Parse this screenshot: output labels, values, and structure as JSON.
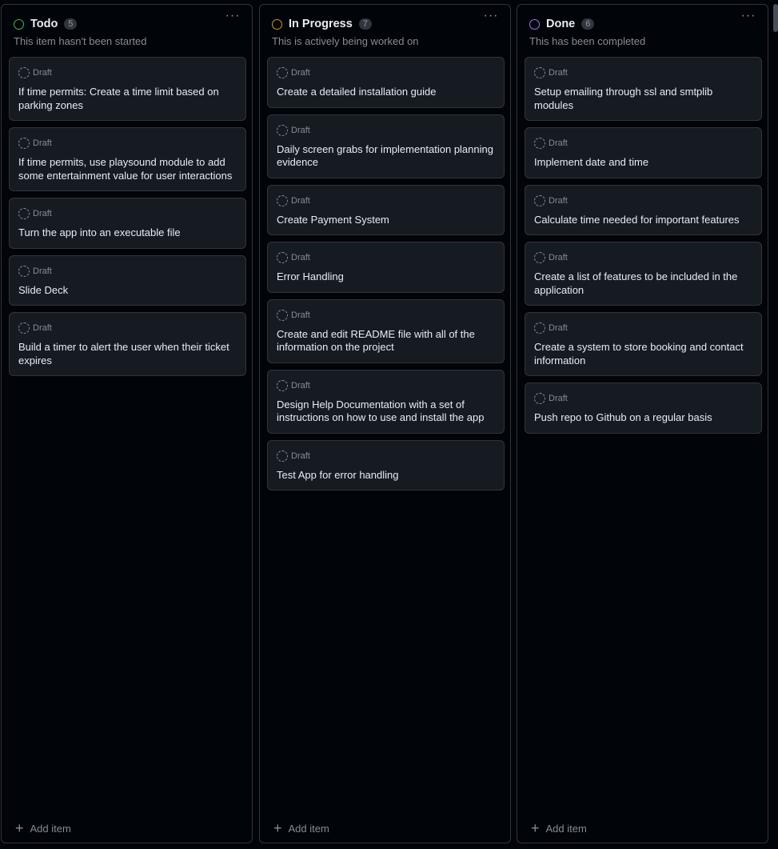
{
  "columns": [
    {
      "title": "Todo",
      "count": "5",
      "description": "This item hasn't been started",
      "status_color": "#3fb950",
      "more": "···",
      "add_label": "Add item",
      "cards": [
        {
          "draft": "Draft",
          "title": "If time permits: Create a time limit based on parking zones"
        },
        {
          "draft": "Draft",
          "title": "If time permits, use playsound module to add some entertainment value for user interactions"
        },
        {
          "draft": "Draft",
          "title": "Turn the app into an executable file"
        },
        {
          "draft": "Draft",
          "title": "Slide Deck"
        },
        {
          "draft": "Draft",
          "title": "Build a timer to alert the user when their ticket expires"
        }
      ]
    },
    {
      "title": "In Progress",
      "count": "7",
      "description": "This is actively being worked on",
      "status_color": "#d29922",
      "more": "···",
      "add_label": "Add item",
      "cards": [
        {
          "draft": "Draft",
          "title": "Create a detailed installation guide"
        },
        {
          "draft": "Draft",
          "title": "Daily screen grabs for implementation planning evidence"
        },
        {
          "draft": "Draft",
          "title": "Create Payment System"
        },
        {
          "draft": "Draft",
          "title": "Error Handling"
        },
        {
          "draft": "Draft",
          "title": "Create and edit README file with all of the information on the project"
        },
        {
          "draft": "Draft",
          "title": "Design Help Documentation with a set of instructions on how to use and install the app"
        },
        {
          "draft": "Draft",
          "title": "Test App for error handling"
        }
      ]
    },
    {
      "title": "Done",
      "count": "6",
      "description": "This has been completed",
      "status_color": "#a371f7",
      "more": "···",
      "add_label": "Add item",
      "cards": [
        {
          "draft": "Draft",
          "title": "Setup emailing through ssl and smtplib modules"
        },
        {
          "draft": "Draft",
          "title": "Implement date and time"
        },
        {
          "draft": "Draft",
          "title": "Calculate time needed for important features"
        },
        {
          "draft": "Draft",
          "title": "Create a list of features to be included in the application"
        },
        {
          "draft": "Draft",
          "title": "Create a system to store booking and contact information"
        },
        {
          "draft": "Draft",
          "title": "Push repo to Github on a regular basis"
        }
      ]
    }
  ]
}
